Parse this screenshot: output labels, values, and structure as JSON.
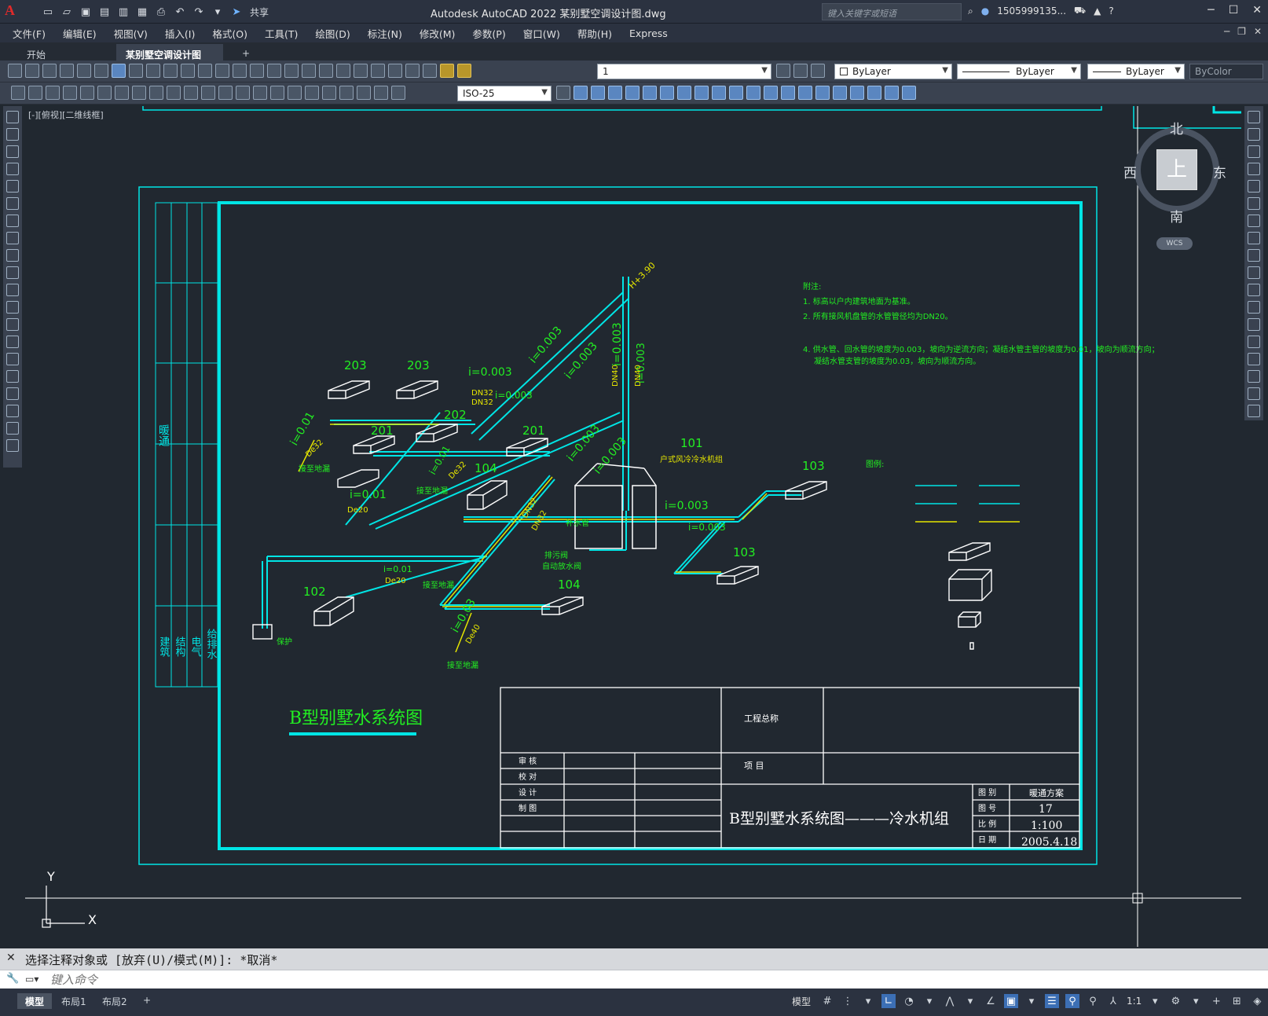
{
  "app": {
    "logo_letter": "A",
    "title": "Autodesk AutoCAD 2022    某别墅空调设计图.dwg",
    "share_label": "共享",
    "search_placeholder": "键入关键字或短语",
    "user": "1505999135...",
    "help": "?"
  },
  "menu": [
    "文件(F)",
    "编辑(E)",
    "视图(V)",
    "插入(I)",
    "格式(O)",
    "工具(T)",
    "绘图(D)",
    "标注(N)",
    "修改(M)",
    "参数(P)",
    "窗口(W)",
    "帮助(H)",
    "Express"
  ],
  "tabs": {
    "start": "开始",
    "active": "某别墅空调设计图*",
    "close": "✕",
    "add": "+"
  },
  "toolbar": {
    "layer_value": "1",
    "color_value": "ByLayer",
    "linetype_value": "ByLayer",
    "lineweight_value": "ByLayer",
    "plotstyle_value": "ByColor",
    "dimstyle_value": "ISO-25"
  },
  "viewport": {
    "label": "[-][俯视][二维线框]"
  },
  "viewcube": {
    "north": "北",
    "south": "南",
    "east": "东",
    "west": "西",
    "top": "上",
    "wcs": "WCS"
  },
  "ucs": {
    "x": "X",
    "y": "Y"
  },
  "drawing": {
    "title": "B型别墅水系统图",
    "notes_head": "附注:",
    "note1": "1. 标高以户内建筑地面为基准。",
    "note2": "2. 所有接风机盘管的水管管径均为DN20。",
    "note4a": "4. 供水管、回水管的坡度为0.003，坡向为逆流方向；凝结水管主管的坡度为0.01，坡向为顺流方向；",
    "note4b": "凝结水管支管的坡度为0.03，坡向为顺流方向。",
    "legend_head": "图例:",
    "side_label_1": "暖通",
    "side_labels": [
      "建筑",
      "结构",
      "电气",
      "给排水"
    ],
    "units": [
      {
        "id": "u203a",
        "label": "203"
      },
      {
        "id": "u203b",
        "label": "203"
      },
      {
        "id": "u201a",
        "label": "201"
      },
      {
        "id": "u202",
        "label": "202"
      },
      {
        "id": "u201b",
        "label": "201"
      },
      {
        "id": "u104a",
        "label": "104"
      },
      {
        "id": "u101",
        "label": "101"
      },
      {
        "id": "u103a",
        "label": "103"
      },
      {
        "id": "u103b",
        "label": "103"
      },
      {
        "id": "u104b",
        "label": "104"
      },
      {
        "id": "u102",
        "label": "102"
      }
    ],
    "pipe_labels": {
      "s1": "i=0.003",
      "s2": "i=0.003",
      "s3": "i=0.003",
      "s4": "i=0.003",
      "s5": "i=0.003",
      "s6": "i=0.003",
      "s7": "i=0.003",
      "s8": "i=0.003",
      "s9": "i=0.003",
      "c1": "i=0.01",
      "c2": "i=0.01",
      "c3": "i=0.01",
      "c4": "i=0.01",
      "c5": "i=0.03",
      "d1": "DN40",
      "d2": "DN40",
      "d3": "DN32",
      "d4": "DN32",
      "d5": "De32",
      "d6": "De32",
      "d7": "De20",
      "d8": "De20",
      "d9": "De40",
      "d10": "DN32",
      "d11": "DN32",
      "h1": "H+3.90",
      "unit101": "户式风冷冷水机组",
      "drain1": "接至地漏",
      "drain2": "接至地漏",
      "drain3": "接至地漏",
      "drain4": "接至地漏",
      "bj": "保护",
      "pz1": "补水管",
      "pz2": "排污阀",
      "pz3": "自动放水阀"
    },
    "titleblock": {
      "project_name_label": "工程总称",
      "project_label": "项  目",
      "rows": [
        "审 核",
        "校 对",
        "设 计",
        "制 图"
      ],
      "drawing_title": "B型别墅水系统图———冷水机组",
      "stage_label": "图 别",
      "stage_value": "暖通方案",
      "no_label": "图 号",
      "no_value": "17",
      "scale_label": "比 例",
      "scale_value": "1:100",
      "date_label": "日 期",
      "date_value": "2005.4.18"
    }
  },
  "command": {
    "history": "选择注释对象或 [放弃(U)/模式(M)]: *取消*",
    "placeholder": "键入命令"
  },
  "status": {
    "layouts": [
      "模型",
      "布局1",
      "布局2"
    ],
    "add": "+",
    "model": "模型",
    "scale": "1:1"
  }
}
